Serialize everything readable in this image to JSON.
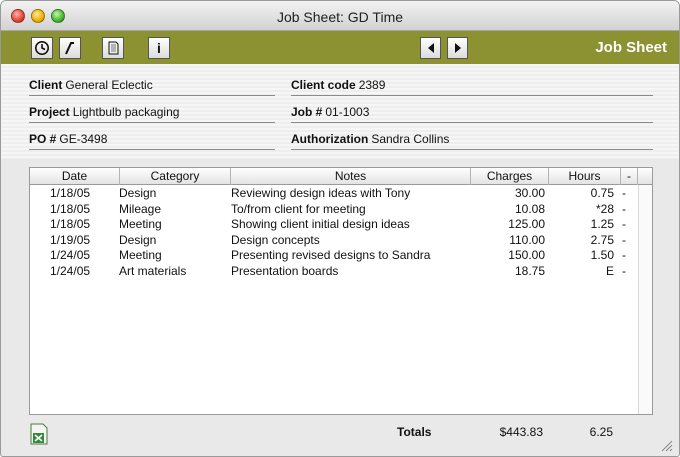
{
  "window": {
    "title": "Job Sheet: GD Time"
  },
  "toolbar": {
    "buttons": [
      {
        "icon": "clock-icon"
      },
      {
        "icon": "pen-icon"
      },
      {
        "icon": "document-icon"
      },
      {
        "icon": "info-icon",
        "label": "i"
      }
    ],
    "nav": [
      {
        "icon": "arrow-left-icon"
      },
      {
        "icon": "arrow-right-icon"
      }
    ],
    "section_label": "Job Sheet",
    "accent_color": "#8c9131"
  },
  "form": {
    "client": {
      "label": "Client",
      "value": "General Eclectic"
    },
    "client_code": {
      "label": "Client code",
      "value": "2389"
    },
    "project": {
      "label": "Project",
      "value": "Lightbulb packaging"
    },
    "job": {
      "label": "Job #",
      "value": "01-1003"
    },
    "po": {
      "label": "PO #",
      "value": "GE-3498"
    },
    "authorization": {
      "label": "Authorization",
      "value": "Sandra Collins"
    }
  },
  "table": {
    "columns": [
      "Date",
      "Category",
      "Notes",
      "Charges",
      "Hours",
      "-"
    ],
    "rows": [
      {
        "date": "1/18/05",
        "category": "Design",
        "notes": "Reviewing design ideas with Tony",
        "charges": "30.00",
        "hours": "0.75",
        "flag": "-"
      },
      {
        "date": "1/18/05",
        "category": "Mileage",
        "notes": "To/from client for meeting",
        "charges": "10.08",
        "hours": "*28",
        "flag": "-"
      },
      {
        "date": "1/18/05",
        "category": "Meeting",
        "notes": "Showing client initial design ideas",
        "charges": "125.00",
        "hours": "1.25",
        "flag": "-"
      },
      {
        "date": "1/19/05",
        "category": "Design",
        "notes": "Design concepts",
        "charges": "110.00",
        "hours": "2.75",
        "flag": "-"
      },
      {
        "date": "1/24/05",
        "category": "Meeting",
        "notes": "Presenting revised designs to Sandra",
        "charges": "150.00",
        "hours": "1.50",
        "flag": "-"
      },
      {
        "date": "1/24/05",
        "category": "Art materials",
        "notes": "Presentation boards",
        "charges": "18.75",
        "hours": "E",
        "flag": "-"
      }
    ]
  },
  "totals": {
    "label": "Totals",
    "charges": "$443.83",
    "hours": "6.25"
  },
  "footer": {
    "export_icon": "excel-icon"
  }
}
